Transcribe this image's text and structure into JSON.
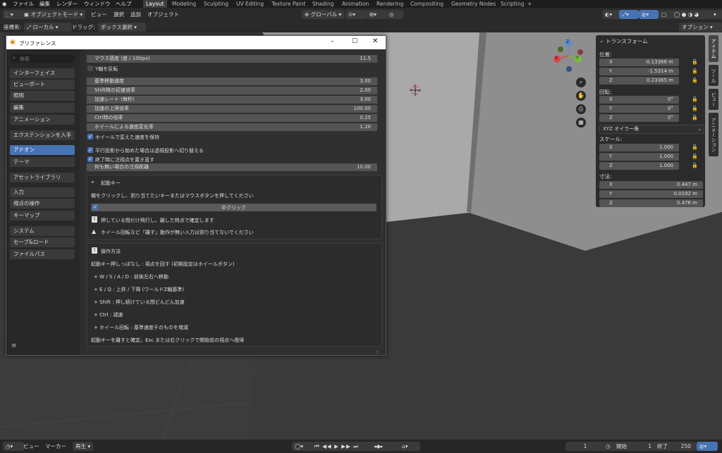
{
  "topbar": {
    "menus": [
      "ファイル",
      "編集",
      "レンダー",
      "ウィンドウ",
      "ヘルプ"
    ],
    "workspace_tabs": [
      "Layout",
      "Modeling",
      "Sculpting",
      "UV Editing",
      "Texture Paint",
      "Shading",
      "Animation",
      "Rendering",
      "Compositing",
      "Geometry Nodes",
      "Scripting"
    ],
    "add_tab": "+"
  },
  "viewport_header": {
    "mode": "オブジェクトモード",
    "menus": [
      "ビュー",
      "選択",
      "追加",
      "オブジェクト"
    ],
    "transform_orientation": "グローバル",
    "coord_label": "座標系:",
    "coord_value": "ローカル",
    "drag_label": "ドラッグ:",
    "drag_value": "ボックス選択",
    "options": "オプション"
  },
  "npanel": {
    "title": "トランスフォーム",
    "location_label": "位置:",
    "location": [
      {
        "axis": "X",
        "value": "-0.13366 m"
      },
      {
        "axis": "Y",
        "value": "-1.5314 m"
      },
      {
        "axis": "Z",
        "value": "0.23365 m"
      }
    ],
    "rotation_label": "回転:",
    "rotation": [
      {
        "axis": "X",
        "value": "0°"
      },
      {
        "axis": "Y",
        "value": "0°"
      },
      {
        "axis": "Z",
        "value": "0°"
      }
    ],
    "rotation_mode": "XYZ オイラー角",
    "scale_label": "スケール:",
    "scale": [
      {
        "axis": "X",
        "value": "1.000"
      },
      {
        "axis": "Y",
        "value": "1.000"
      },
      {
        "axis": "Z",
        "value": "1.000"
      }
    ],
    "dimensions_label": "寸法:",
    "dimensions": [
      {
        "axis": "X",
        "value": "0.447 m"
      },
      {
        "axis": "Y",
        "value": "0.0192 m"
      },
      {
        "axis": "Z",
        "value": "0.476 m"
      }
    ],
    "side_tabs": [
      "アイテム",
      "ツール",
      "ビュー",
      "アニメーション"
    ]
  },
  "gizmo": {
    "x": "X",
    "y": "Y",
    "z": "Z"
  },
  "prefs": {
    "title": "プリファレンス",
    "search_placeholder": "検索",
    "nav_groups": [
      [
        "インターフェイス",
        "ビューポート",
        "照明",
        "編集",
        "アニメーション"
      ],
      [
        "エクステンションを入手"
      ],
      [
        "アドオン",
        "テーマ"
      ],
      [
        "アセットライブラリ"
      ],
      [
        "入力",
        "視点の操作",
        "キーマップ"
      ],
      [
        "システム",
        "セーブ&ロード",
        "ファイルパス"
      ]
    ],
    "active_nav": "アドオン",
    "mouse_sensitivity": {
      "label": "マウス感度 (度 / 100px)",
      "value": "11.5"
    },
    "invert_y": {
      "label": "Y軸を反転"
    },
    "speed_rows": [
      {
        "label": "基準移動速度",
        "value": "3.00"
      },
      {
        "label": "Shift時の初速倍率",
        "value": "2.00"
      },
      {
        "label": "加速レート (毎秒)",
        "value": "3.00"
      },
      {
        "label": "加速の上限倍率",
        "value": "100.00"
      },
      {
        "label": "Ctrl時の倍率",
        "value": "0.25"
      },
      {
        "label": "ホイールによる速度変化率",
        "value": "1.20"
      }
    ],
    "wheel_keep": "ホイールで変えた速度を保持",
    "ortho_switch": "平行投影から始めた場合は透視投影へ切り替える",
    "reset_pivot": "終了時に注視点を置き直す",
    "default_distance": {
      "label": "何も無い場合の注視距離",
      "value": "10.00"
    },
    "startup": {
      "header": "起動キー",
      "instruction": "欄をクリックし、割り当てたいキーまたはマウスボタンを押してください",
      "key_value": "中クリック",
      "hold_text": "押している間だけ飛行し、離した時点で確定します",
      "warning_text": "ホイール回転など「離す」動作が無い入力は割り当てないでください"
    },
    "howto": {
      "header": "操作方法",
      "lines": [
        "起動キー押しっぱなし : 視点を回す (初期設定はホイールボタン)",
        "+ W / S / A / D : 前後左右へ移動",
        "+ E / Q : 上昇 / 下降 (ワールドZ軸基準)",
        "+ Shift : 押し続けている間どんどん加速",
        "+ Ctrl : 減速",
        "+ ホイール回転 : 基準速度そのものを増減",
        "起動キーを離すと確定。Esc または右クリックで開始前の視点へ復帰"
      ]
    }
  },
  "timeline": {
    "menus": [
      "ビュー",
      "マーカー"
    ],
    "playback": "再生",
    "current_frame": "1",
    "start_label": "開始",
    "start_value": "1",
    "end_label": "終了",
    "end_value": "250"
  }
}
